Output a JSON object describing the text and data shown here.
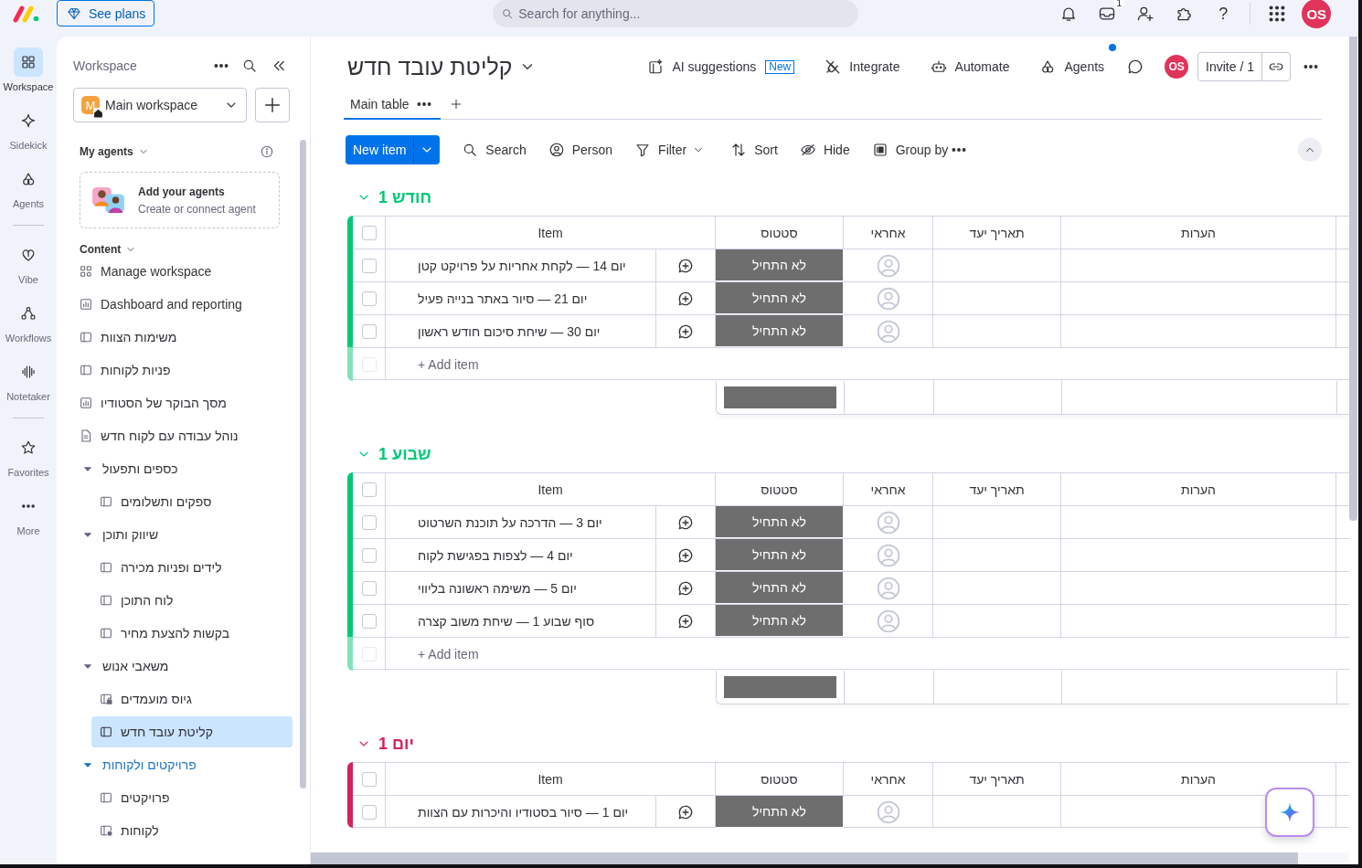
{
  "topbar": {
    "plans_button": "See plans",
    "search": {
      "placeholder": "Search for anything..."
    },
    "inbox_badge": "1",
    "help": "?",
    "avatar": "OS"
  },
  "rail": {
    "sections": [
      [
        {
          "label": "Workspace",
          "selected": true
        },
        {
          "label": "Sidekick",
          "selected": false
        },
        {
          "label": "Agents",
          "selected": false
        }
      ],
      [
        {
          "label": "Vibe",
          "selected": false
        },
        {
          "label": "Workflows",
          "selected": false
        },
        {
          "label": "Notetaker",
          "selected": false
        }
      ],
      [
        {
          "label": "Favorites",
          "selected": false
        },
        {
          "label": "More",
          "selected": false
        }
      ]
    ]
  },
  "sidebar": {
    "title": "Workspace",
    "workspace": {
      "initial": "M",
      "name": "Main workspace"
    },
    "agents": {
      "heading": "My agents",
      "card_title": "Add your agents",
      "card_subtitle": "Create or connect agent"
    },
    "content_heading": "Content",
    "items": [
      {
        "label": "Manage workspace",
        "kind": "manage",
        "selected": false
      },
      {
        "label": "Dashboard and reporting",
        "kind": "dashboard",
        "selected": false
      },
      {
        "label": "משימות הצוות",
        "kind": "board",
        "selected": false
      },
      {
        "label": "פניות לקוחות",
        "kind": "board",
        "selected": false
      },
      {
        "label": "מסך הבוקר של הסטודיו",
        "kind": "dashboard",
        "selected": false
      },
      {
        "label": "נוהל עבודה עם לקוח חדש",
        "kind": "doc",
        "selected": false
      },
      {
        "label": "כספים ותפעול",
        "kind": "folder",
        "expanded": true,
        "highlighted": false,
        "selected": false,
        "children": [
          {
            "label": "ספקים ותשלומים",
            "kind": "board",
            "selected": false
          }
        ]
      },
      {
        "label": "שיווק ותוכן",
        "kind": "folder",
        "expanded": true,
        "highlighted": false,
        "selected": false,
        "children": [
          {
            "label": "לידים ופניות מכירה",
            "kind": "board",
            "selected": false
          },
          {
            "label": "לוח התוכן",
            "kind": "board",
            "selected": false
          },
          {
            "label": "בקשות להצעת מחיר",
            "kind": "board",
            "selected": false
          }
        ]
      },
      {
        "label": "משאבי אנוש",
        "kind": "folder",
        "expanded": true,
        "highlighted": false,
        "selected": false,
        "children": [
          {
            "label": "גיוס מועמדים",
            "kind": "private",
            "selected": false
          },
          {
            "label": "קליטת עובד חדש",
            "kind": "board",
            "selected": true
          }
        ]
      },
      {
        "label": "פרויקטים ולקוחות",
        "kind": "folder",
        "expanded": true,
        "highlighted": true,
        "selected": false,
        "children": [
          {
            "label": "פרויקטים",
            "kind": "board",
            "selected": false
          },
          {
            "label": "לקוחות",
            "kind": "shared",
            "selected": false
          }
        ]
      }
    ]
  },
  "board": {
    "title": "קליטת עובד חדש",
    "toolbar": {
      "ai": "AI suggestions",
      "new_badge": "New",
      "integrate": "Integrate",
      "automate": "Automate",
      "agents": "Agents",
      "agents_unread": true,
      "avatar": "OS",
      "invite": "Invite / 1"
    },
    "views": [
      {
        "label": "Main table",
        "selected": true
      }
    ],
    "actions": {
      "new_item": "New item",
      "search": "Search",
      "person": "Person",
      "filter": "Filter",
      "sort": "Sort",
      "hide": "Hide",
      "group_by": "Group by"
    },
    "groups": [
      {
        "title": "חודש 1",
        "color": "#00c875",
        "expanded": true,
        "all_checked": false,
        "columns": {
          "item": "Item",
          "status": "סטטוס",
          "owner": "אחראי",
          "due_date": "תאריך יעד",
          "notes": "הערות"
        },
        "add_row": {
          "label": "+ Add item",
          "checked": false
        },
        "rows": [
          {
            "item": "יום 14 — לקחת אחריות על פרויקט קטן",
            "status": "לא התחיל",
            "checked": false
          },
          {
            "item": "יום 21 — סיור באתר בנייה פעיל",
            "status": "לא התחיל",
            "checked": false
          },
          {
            "item": "יום 30 — שיחת סיכום חודש ראשון",
            "status": "לא התחיל",
            "checked": false
          }
        ]
      },
      {
        "title": "שבוע 1",
        "color": "#00c875",
        "expanded": true,
        "all_checked": false,
        "columns": {
          "item": "Item",
          "status": "סטטוס",
          "owner": "אחראי",
          "due_date": "תאריך יעד",
          "notes": "הערות"
        },
        "add_row": {
          "label": "+ Add item",
          "checked": false
        },
        "rows": [
          {
            "item": "יום 3 — הדרכה על תוכנת השרטוט",
            "status": "לא התחיל",
            "checked": false
          },
          {
            "item": "יום 4 — לצפות בפגישת לקוח",
            "status": "לא התחיל",
            "checked": false
          },
          {
            "item": "יום 5 — משימה ראשונה בליווי",
            "status": "לא התחיל",
            "checked": false
          },
          {
            "item": "סוף שבוע 1 — שיחת משוב קצרה",
            "status": "לא התחיל",
            "checked": false
          }
        ]
      },
      {
        "title": "יום 1",
        "color": "#d2245a",
        "expanded": true,
        "all_checked": false,
        "columns": {
          "item": "Item",
          "status": "סטטוס",
          "owner": "אחראי",
          "due_date": "תאריך יעד",
          "notes": "הערות"
        },
        "rows": [
          {
            "item": "יום 1 — סיור בסטודיו והיכרות עם הצוות",
            "status": "לא התחיל",
            "checked": false
          }
        ]
      }
    ]
  }
}
